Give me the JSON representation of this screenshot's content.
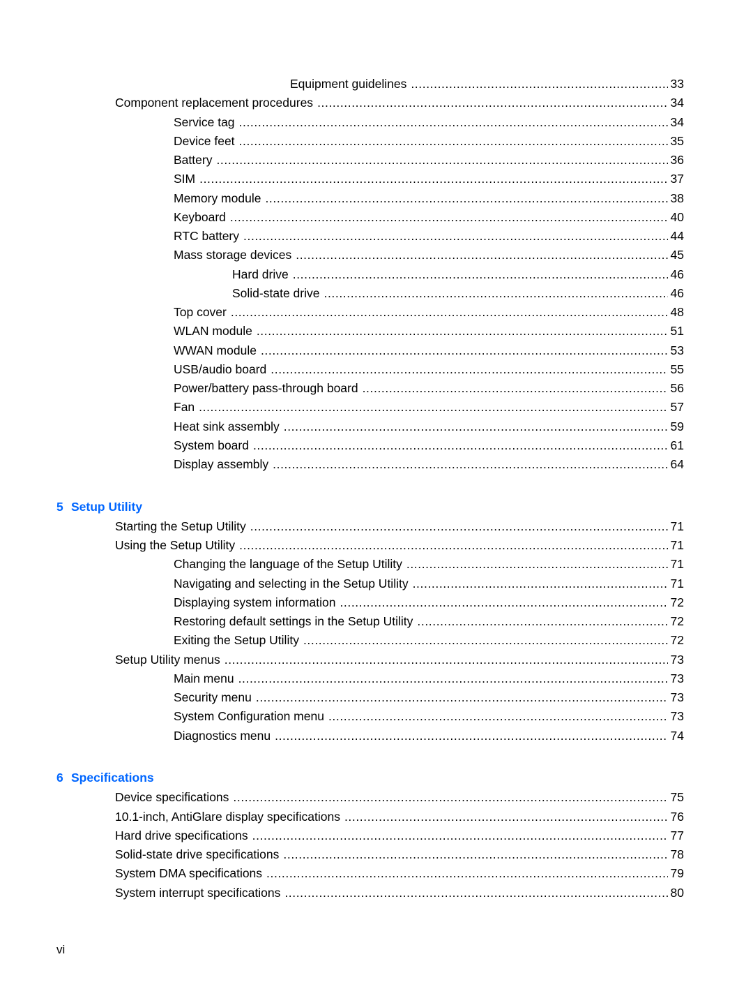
{
  "sections": [
    {
      "entries": [
        {
          "level": 4,
          "title": "Equipment guidelines",
          "page": "33"
        },
        {
          "level": 2,
          "title": "Component replacement procedures",
          "page": "34"
        },
        {
          "level": 3,
          "title": "Service tag",
          "page": "34"
        },
        {
          "level": 3,
          "title": "Device feet",
          "page": "35"
        },
        {
          "level": 3,
          "title": "Battery",
          "page": "36"
        },
        {
          "level": 3,
          "title": "SIM",
          "page": "37"
        },
        {
          "level": 3,
          "title": "Memory module",
          "page": "38"
        },
        {
          "level": 3,
          "title": "Keyboard",
          "page": "40"
        },
        {
          "level": 3,
          "title": "RTC battery",
          "page": "44"
        },
        {
          "level": 3,
          "title": "Mass storage devices",
          "page": "45"
        },
        {
          "level": 4,
          "title": "Hard drive",
          "page": "46"
        },
        {
          "level": 4,
          "title": "Solid-state drive",
          "page": "46"
        },
        {
          "level": 3,
          "title": "Top cover",
          "page": "48"
        },
        {
          "level": 3,
          "title": "WLAN module",
          "page": "51"
        },
        {
          "level": 3,
          "title": "WWAN module",
          "page": "53"
        },
        {
          "level": 3,
          "title": "USB/audio board",
          "page": "55"
        },
        {
          "level": 3,
          "title": "Power/battery pass-through board",
          "page": "56"
        },
        {
          "level": 3,
          "title": "Fan",
          "page": "57"
        },
        {
          "level": 3,
          "title": "Heat sink assembly",
          "page": "59"
        },
        {
          "level": 3,
          "title": "System board",
          "page": "61"
        },
        {
          "level": 3,
          "title": "Display assembly",
          "page": "64"
        }
      ]
    },
    {
      "chapter_number": "5",
      "chapter_title": "Setup Utility",
      "entries": [
        {
          "level": 2,
          "title": "Starting the Setup Utility",
          "page": "71"
        },
        {
          "level": 2,
          "title": "Using the Setup Utility",
          "page": "71"
        },
        {
          "level": 3,
          "title": "Changing the language of the Setup Utility",
          "page": "71"
        },
        {
          "level": 3,
          "title": "Navigating and selecting in the Setup Utility",
          "page": "71"
        },
        {
          "level": 3,
          "title": "Displaying system information",
          "page": "72"
        },
        {
          "level": 3,
          "title": "Restoring default settings in the Setup Utility",
          "page": "72"
        },
        {
          "level": 3,
          "title": "Exiting the Setup Utility",
          "page": "72"
        },
        {
          "level": 2,
          "title": "Setup Utility menus",
          "page": "73"
        },
        {
          "level": 3,
          "title": "Main menu",
          "page": "73"
        },
        {
          "level": 3,
          "title": "Security menu",
          "page": "73"
        },
        {
          "level": 3,
          "title": "System Configuration menu",
          "page": "73"
        },
        {
          "level": 3,
          "title": "Diagnostics menu",
          "page": "74"
        }
      ]
    },
    {
      "chapter_number": "6",
      "chapter_title": "Specifications",
      "entries": [
        {
          "level": 2,
          "title": "Device specifications",
          "page": "75"
        },
        {
          "level": 2,
          "title": "10.1-inch, AntiGlare display specifications",
          "page": "76"
        },
        {
          "level": 2,
          "title": "Hard drive specifications",
          "page": "77"
        },
        {
          "level": 2,
          "title": "Solid-state drive specifications",
          "page": "78"
        },
        {
          "level": 2,
          "title": "System DMA specifications",
          "page": "79"
        },
        {
          "level": 2,
          "title": "System interrupt specifications",
          "page": "80"
        }
      ]
    }
  ],
  "colors": {
    "heading": "#0066ff",
    "text": "#000000"
  },
  "footer": {
    "page_number": "vi"
  }
}
